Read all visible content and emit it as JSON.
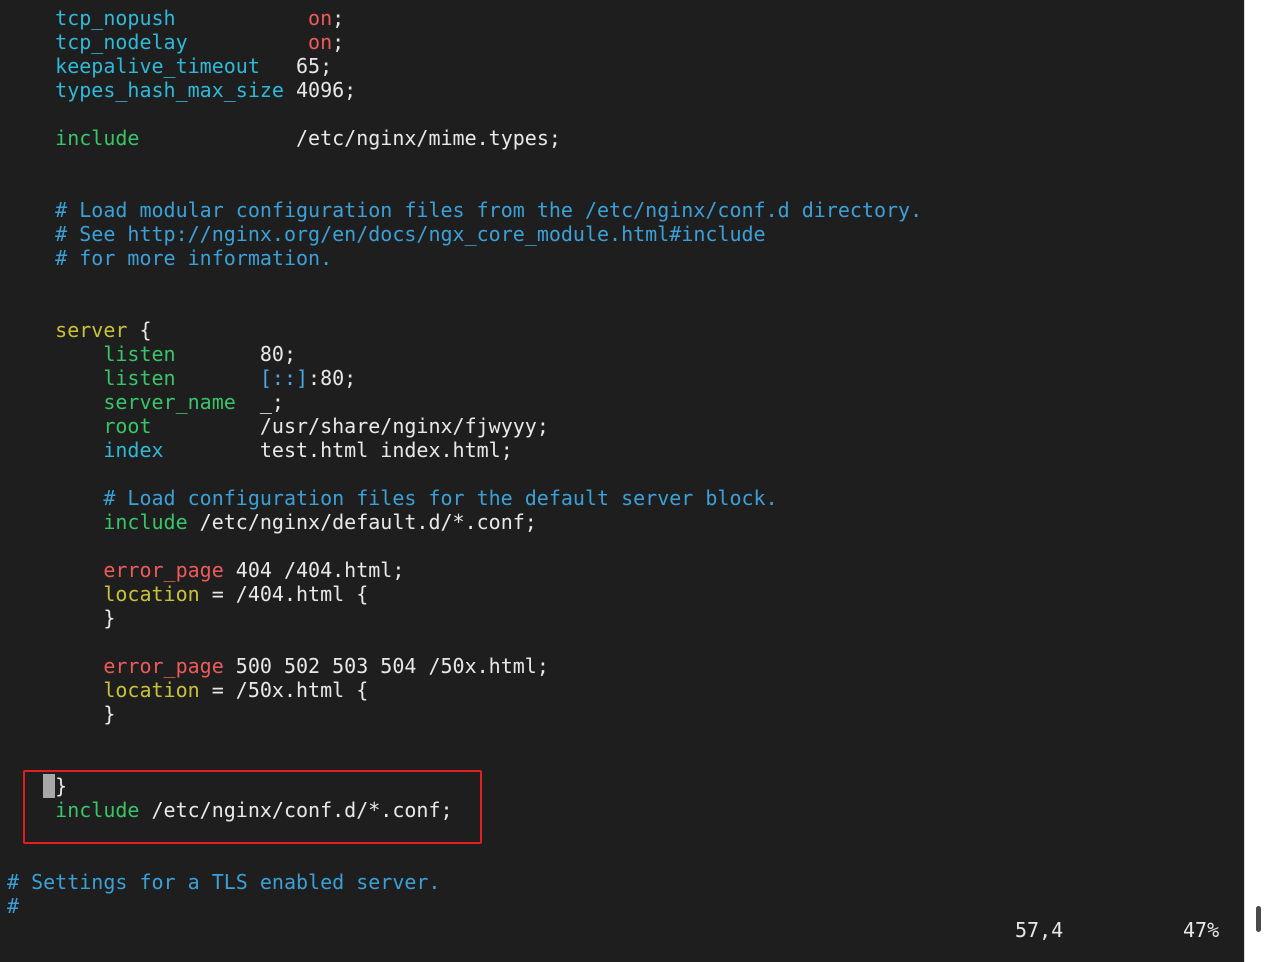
{
  "editor": {
    "lines": {
      "l1_key": "tcp_nopush",
      "l1_val": "on",
      "l1_end": ";",
      "l2_key": "tcp_nodelay",
      "l2_val": "on",
      "l2_end": ";",
      "l3_key": "keepalive_timeout",
      "l3_val": "65;",
      "l4_key": "types_hash_max_size",
      "l4_val": "4096;",
      "l5_key": "include",
      "l5_val": "/etc/nginx/mime.types;",
      "c1": "# Load modular configuration files from the /etc/nginx/conf.d directory.",
      "c2": "# See http://nginx.org/en/docs/ngx_core_module.html#include",
      "c3": "# for more information.",
      "s_key": "server",
      "s_brace": " {",
      "listen1_key": "listen",
      "listen1_val": "80;",
      "listen2_key": "listen",
      "listen2_bracket": "[::]",
      "listen2_val": ":80;",
      "sname_key": "server_name",
      "sname_val": "_;",
      "root_key": "root",
      "root_val": "/usr/share/nginx/fjwyyy;",
      "index_key": "index",
      "index_val": "test.html index.html;",
      "c4": "# Load configuration files for the default server block.",
      "inc2_key": "include",
      "inc2_val": " /etc/nginx/default.d/*.conf;",
      "ep1_key": "error_page",
      "ep1_val": " 404 /404.html;",
      "loc1_key": "location",
      "loc1_val": " = /404.html {",
      "close1": "}",
      "ep2_key": "error_page",
      "ep2_val": " 500 502 503 504 /50x.html;",
      "loc2_key": "location",
      "loc2_val": " = /50x.html {",
      "close2": "}",
      "close_server": "}",
      "inc3_key": "include",
      "inc3_val": " /etc/nginx/conf.d/*.conf;",
      "c5": "# Settings for a TLS enabled server.",
      "c6": "#"
    }
  },
  "status": {
    "cursor_position": "57,4",
    "scroll_percent": "47%"
  },
  "colors": {
    "background": "#1e1e1e",
    "keyword_cyan": "#2fb8d8",
    "keyword_green": "#3ac46a",
    "keyword_yellow": "#c8c238",
    "keyword_red": "#ee5a5a",
    "comment": "#3ca0d8",
    "highlight_box": "#e02020"
  }
}
